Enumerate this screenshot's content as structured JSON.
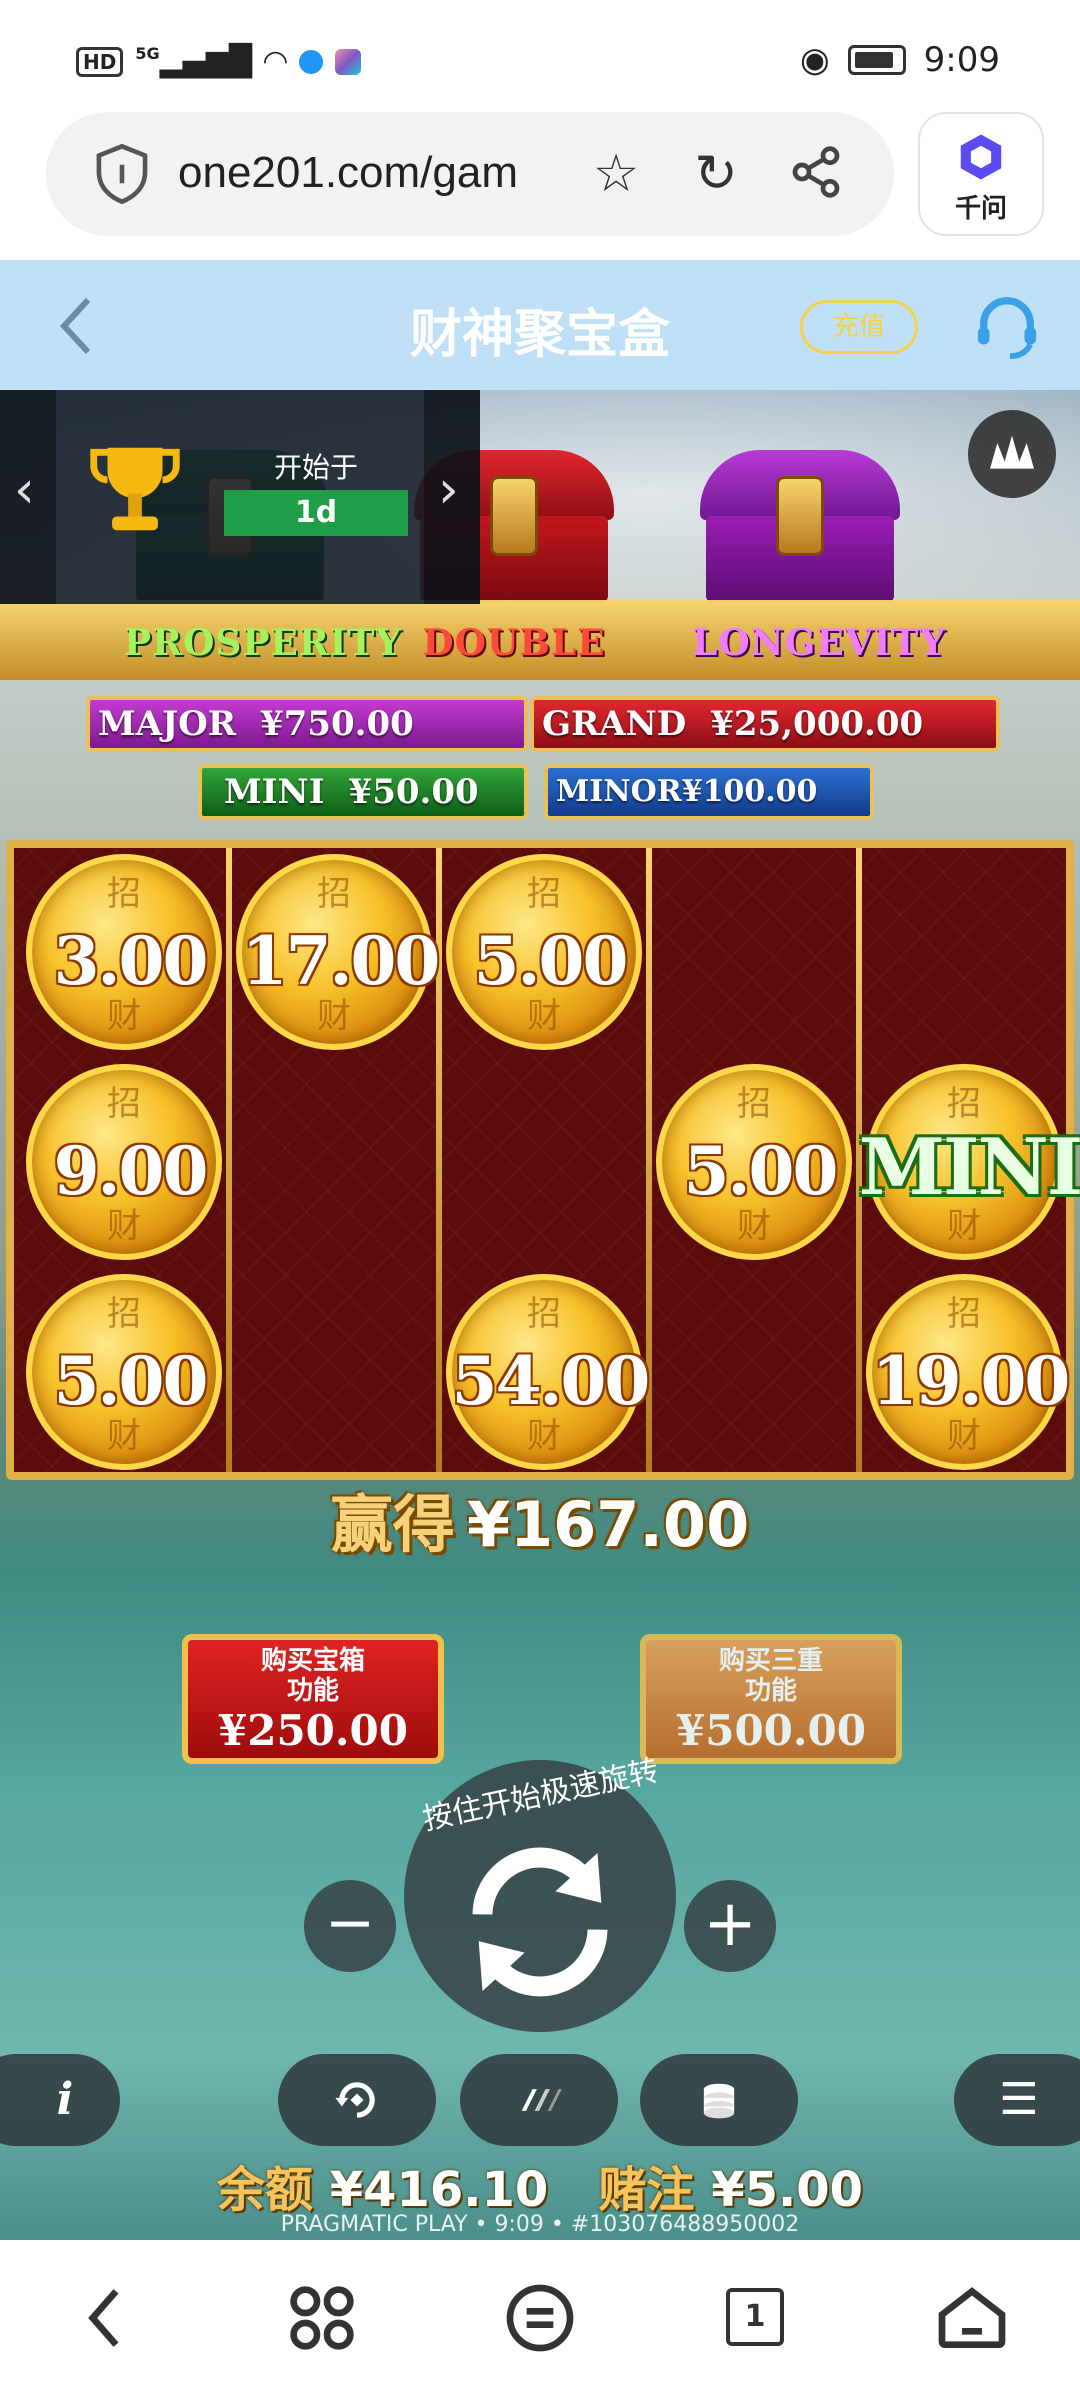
{
  "status_bar": {
    "network_badge": "HD",
    "signal_label": "5G",
    "time": "9:09"
  },
  "browser": {
    "url": "one201.com/gam",
    "assistant_label": "千问"
  },
  "game_header": {
    "title": "财神聚宝盒",
    "recharge_label": "充值"
  },
  "tournament": {
    "starts_label": "开始于",
    "starts_value": "1d"
  },
  "chests": [
    {
      "label": "PROSPERITY",
      "color": "#1f7a2a"
    },
    {
      "label": "DOUBLE",
      "color": "#c2161c"
    },
    {
      "label": "LONGEVITY",
      "color": "#9b1db5"
    }
  ],
  "jackpots": {
    "major": {
      "label": "MAJOR",
      "value": "¥750.00"
    },
    "grand": {
      "label": "GRAND",
      "value": "¥25,000.00"
    },
    "mini": {
      "label": "MINI",
      "value": "¥50.00"
    },
    "minor": {
      "label": "MINOR",
      "value": "¥100.00"
    }
  },
  "reels": {
    "coin_char_top": "招",
    "coin_char_bottom": "财",
    "r1c1": "3.00",
    "r1c2": "17.00",
    "r1c3": "5.00",
    "r2c1": "9.00",
    "r2c4": "5.00",
    "r2c5": "MINI",
    "r3c1": "5.00",
    "r3c3": "54.00",
    "r3c5": "19.00"
  },
  "win": {
    "label": "赢得",
    "value": "¥167.00"
  },
  "buy_buttons": [
    {
      "title": "购买宝箱\n功能",
      "price": "¥250.00"
    },
    {
      "title": "购买三重\n功能",
      "price": "¥500.00"
    }
  ],
  "spin": {
    "hint": "按住开始极速旋转"
  },
  "bottom": {
    "balance_label": "余额",
    "balance_value": "¥416.10",
    "bet_label": "赌注",
    "bet_value": "¥5.00",
    "footer": "PRAGMATIC PLAY • 9:09 • #103076488950002"
  },
  "nav": {
    "tab_count": "1"
  },
  "colors": {
    "header_bg": "#bfe0f6",
    "reel_bg": "#5c0b0b",
    "gold": "#e1b04a"
  }
}
